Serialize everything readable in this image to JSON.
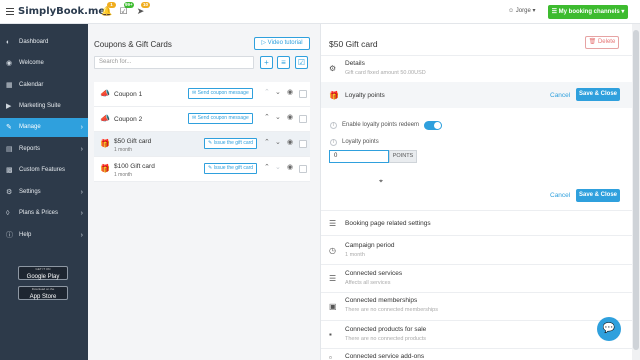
{
  "topbar": {
    "logo": "SimplyBook.me",
    "badges": {
      "bell": "1",
      "tasks": "99+",
      "send": "10"
    },
    "user_name": "Jorge",
    "my_channels": "My booking channels"
  },
  "sidebar": {
    "items": [
      {
        "label": "Dashboard",
        "icon": "speedometer-icon"
      },
      {
        "label": "Welcome",
        "icon": "globe-icon"
      },
      {
        "label": "Calendar",
        "icon": "calendar-icon"
      },
      {
        "label": "Marketing Suite",
        "icon": "megaphone-icon"
      },
      {
        "label": "Manage",
        "icon": "pencil-icon"
      },
      {
        "label": "Reports",
        "icon": "chart-icon"
      },
      {
        "label": "Custom Features",
        "icon": "puzzle-icon"
      },
      {
        "label": "Settings",
        "icon": "gear-icon"
      },
      {
        "label": "Plans & Prices",
        "icon": "tag-icon"
      },
      {
        "label": "Help",
        "icon": "help-icon"
      }
    ],
    "google_play": {
      "small": "GET IT ON",
      "label": "Google Play"
    },
    "app_store": {
      "small": "Download on the",
      "label": "App Store"
    }
  },
  "middle": {
    "title": "Coupons & Gift Cards",
    "video_tutorial": "Video tutorial",
    "search_placeholder": "Search for...",
    "rows": [
      {
        "name": "Coupon 1",
        "sub": "",
        "action": "Send coupon message",
        "icon": "megaphone-icon"
      },
      {
        "name": "Coupon 2",
        "sub": "",
        "action": "Send coupon message",
        "icon": "megaphone-icon"
      },
      {
        "name": "$50 Gift card",
        "sub": "1 month",
        "action": "Issue the gift card",
        "icon": "gift-icon"
      },
      {
        "name": "$100 Gift card",
        "sub": "1 month",
        "action": "Issue the gift card",
        "icon": "gift-icon"
      }
    ]
  },
  "right": {
    "title": "$50 Gift card",
    "delete": "Delete",
    "details": {
      "title": "Details",
      "sub": "Gift card fixed amount 50.00USD"
    },
    "loyalty": {
      "title": "Loyalty points",
      "cancel": "Cancel",
      "save_close": "Save & Close",
      "enable_label": "Enable loyalty points redeem",
      "points_label": "Loyalty points",
      "points_value": "0",
      "points_unit": "POINTS"
    },
    "sections": [
      {
        "title": "Booking page related settings",
        "sub": "",
        "icon": "sliders-icon"
      },
      {
        "title": "Campaign period",
        "sub": "1 month",
        "icon": "clock-icon"
      },
      {
        "title": "Connected services",
        "sub": "Affects all services",
        "icon": "list-icon"
      },
      {
        "title": "Connected memberships",
        "sub": "There are no connected memberships",
        "icon": "card-icon"
      },
      {
        "title": "Connected products for sale",
        "sub": "There are no connected products",
        "icon": "box-icon"
      },
      {
        "title": "Connected service add-ons",
        "sub": "",
        "icon": "addon-icon"
      }
    ]
  }
}
